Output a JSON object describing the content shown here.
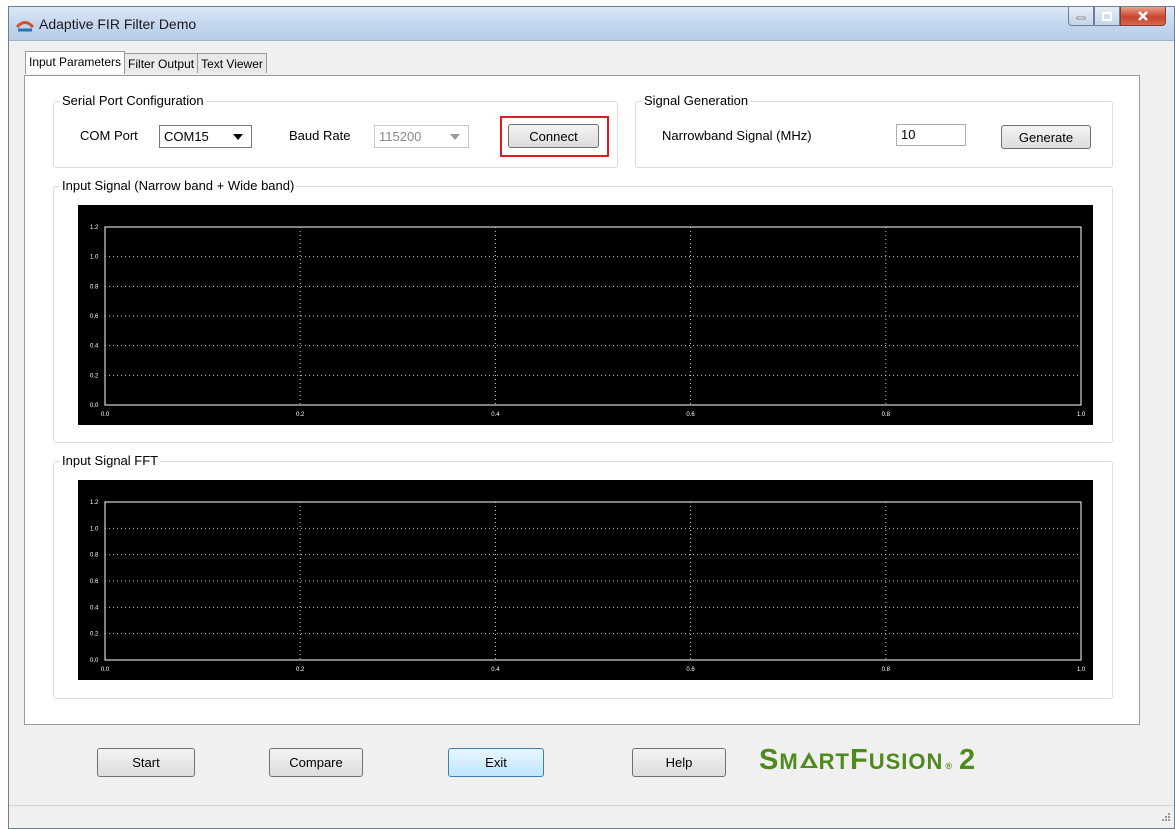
{
  "window": {
    "title": "Adaptive FIR Filter Demo"
  },
  "tabs": [
    {
      "label": "Input Parameters",
      "active": true
    },
    {
      "label": "Filter Output",
      "active": false
    },
    {
      "label": "Text Viewer",
      "active": false
    }
  ],
  "serial_port": {
    "group_title": "Serial Port Configuration",
    "com_port_label": "COM Port",
    "com_port_value": "COM15",
    "baud_rate_label": "Baud Rate",
    "baud_rate_value": "115200",
    "connect_label": "Connect"
  },
  "signal_generation": {
    "group_title": "Signal Generation",
    "narrowband_label": "Narrowband Signal (MHz)",
    "narrowband_value": "10",
    "generate_label": "Generate"
  },
  "input_signal_chart": {
    "group_title": "Input Signal (Narrow band + Wide band)"
  },
  "fft_chart": {
    "group_title": "Input Signal FFT"
  },
  "chart_data": [
    {
      "type": "line",
      "title": "Input Signal (Narrow band + Wide band)",
      "series": [],
      "xlim": [
        0.0,
        1.0
      ],
      "ylim": [
        0.0,
        1.2
      ],
      "x_ticks": [
        "0.0",
        "0.2",
        "0.4",
        "0.6",
        "0.8",
        "1.0"
      ],
      "y_ticks": [
        "0.0",
        "0.2",
        "0.4",
        "0.6",
        "0.8",
        "1.0",
        "1.2"
      ],
      "grid": true,
      "background": "#000000",
      "grid_color": "#c8c8c8"
    },
    {
      "type": "line",
      "title": "Input Signal FFT",
      "series": [],
      "xlim": [
        0.0,
        1.0
      ],
      "ylim": [
        0.0,
        1.2
      ],
      "x_ticks": [
        "0.0",
        "0.2",
        "0.4",
        "0.6",
        "0.8",
        "1.0"
      ],
      "y_ticks": [
        "0.0",
        "0.2",
        "0.4",
        "0.6",
        "0.8",
        "1.0",
        "1.2"
      ],
      "grid": true,
      "background": "#000000",
      "grid_color": "#c8c8c8"
    }
  ],
  "bottom_buttons": {
    "start": "Start",
    "compare": "Compare",
    "exit": "Exit",
    "help": "Help"
  },
  "logo": {
    "text": "SmartFusion2",
    "color": "#4f8a1c"
  },
  "colors": {
    "highlight": "#e01b24",
    "window_bg": "#f0f0f0"
  }
}
